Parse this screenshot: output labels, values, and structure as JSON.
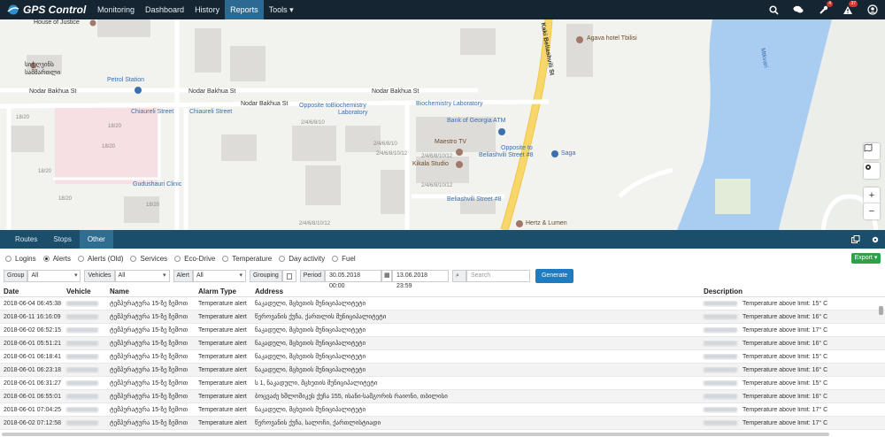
{
  "app": {
    "logo_text": "GPS Control"
  },
  "nav": [
    "Monitoring",
    "Dashboard",
    "History",
    "Reports",
    "Tools"
  ],
  "nav_active": "Reports",
  "top_icons": {
    "wrench_badge": "4",
    "alert_badge": "37"
  },
  "map": {
    "labels": {
      "house_of_justice": "House of Justice",
      "geo_top": "სიჭ ღვინს",
      "geo_bottom": "სამმართლი",
      "petrol_station": "Petrol Station",
      "nodar1": "Nodar Bakhua St",
      "nodar2": "Nodar Bakhua St",
      "nodar3": "Nodar Bakhua St",
      "nodar4": "Nodar Bakhua St",
      "chiaureli1": "Chiaureli Street",
      "chiaureli2": "Chiaureli Street",
      "opposite_bio_1": "Opposite toBiochemistry",
      "opposite_bio_2": "Laboratory",
      "bio_lab": "Biochemistry Laboratory",
      "bank": "Bank of Georgia ATM",
      "maestro": "Maestro TV",
      "kikala": "Kikala Studio",
      "opposite_bel_1": "Opposite to",
      "opposite_bel_2": "Beliashvili Street #8",
      "saga": "Saga",
      "beliashvili8": "Beliashvili Street #8",
      "gudushauri": "Gudushauri Clinic",
      "hertz": "Hertz & Lumen",
      "agava": "Agava hotel Tbilisi",
      "beliashvili_road": "Kaki Beliashvili St",
      "mtkvari": "Mtkvari",
      "n1820a": "18/20",
      "n1820b": "18/20",
      "n1820c": "18/20",
      "n1820d": "18/20",
      "n1820e": "18/20",
      "n18": "18/20",
      "n246a": "2/4/6/8/10",
      "n246b": "2/4/6/8/10",
      "n246c": "2/4/6/8/10/12",
      "n246d": "2/4/6/8/10/12",
      "n246e": "2/4/6/8/10/12",
      "n246f": "2/4/6/8/10/12"
    },
    "controls": {
      "zoom_in": "+",
      "zoom_out": "−"
    }
  },
  "tabs": [
    "Routes",
    "Stops",
    "Other"
  ],
  "tab_active": "Other",
  "report_types": [
    {
      "label": "Logins",
      "selected": false
    },
    {
      "label": "Alerts",
      "selected": true
    },
    {
      "label": "Alerts (Old)",
      "selected": false
    },
    {
      "label": "Services",
      "selected": false
    },
    {
      "label": "Eco-Drive",
      "selected": false
    },
    {
      "label": "Temperature",
      "selected": false
    },
    {
      "label": "Day activity",
      "selected": false
    },
    {
      "label": "Fuel",
      "selected": false
    }
  ],
  "export_label": "Export",
  "filters": {
    "group_label": "Group",
    "group_value": "All",
    "vehicles_label": "Vehicles",
    "vehicles_value": "All",
    "alert_label": "Alert",
    "alert_value": "All",
    "grouping_label": "Grouping",
    "period_label": "Period",
    "from": "30.05.2018 00:00",
    "to": "13.06.2018 23:59",
    "search_placeholder": "Search",
    "generate_label": "Generate"
  },
  "table": {
    "columns": [
      "Date",
      "Vehicle",
      "Name",
      "Alarm Type",
      "Address",
      "Description"
    ],
    "rows": [
      {
        "date": "2018-06-04 06:45:38",
        "name": "ტემპერატურა 15-ზე ზემოთ",
        "type": "Temperature alert",
        "address": "ნაკადული, მცხეთის მუნიციპალიტეტი",
        "desc": "Temperature above limit: 15° C"
      },
      {
        "date": "2018-06-11 16:16:09",
        "name": "ტემპერატურა 15-ზე ზემოთ",
        "type": "Temperature alert",
        "address": "წეროვანის ქუჩა, ქართლის მუნიციპალიტეტი",
        "desc": "Temperature above limit: 16° C"
      },
      {
        "date": "2018-06-02 06:52:15",
        "name": "ტემპერატურა 15-ზე ზემოთ",
        "type": "Temperature alert",
        "address": "ნაკადული, მცხეთის მუნიციპალიტეტი",
        "desc": "Temperature above limit: 17° C"
      },
      {
        "date": "2018-06-01 05:51:21",
        "name": "ტემპერატურა 15-ზე ზემოთ",
        "type": "Temperature alert",
        "address": "ნაკადული, მცხეთის მუნიციპალიტეტი",
        "desc": "Temperature above limit: 16° C"
      },
      {
        "date": "2018-06-01 06:18:41",
        "name": "ტემპერატურა 15-ზე ზემოთ",
        "type": "Temperature alert",
        "address": "ნაკადული, მცხეთის მუნიციპალიტეტი",
        "desc": "Temperature above limit: 15° C"
      },
      {
        "date": "2018-06-01 06:23:18",
        "name": "ტემპერატურა 15-ზე ზემოთ",
        "type": "Temperature alert",
        "address": "ნაკადული, მცხეთის მუნიციპალიტეტი",
        "desc": "Temperature above limit: 16° C"
      },
      {
        "date": "2018-06-01 06:31:27",
        "name": "ტემპერატურა 15-ზე ზემოთ",
        "type": "Temperature alert",
        "address": "ს 1, ნაკადული, მცხეთის მუნიციპალიტეტი",
        "desc": "Temperature above limit: 15° C"
      },
      {
        "date": "2018-06-01 06:55:01",
        "name": "ტემპერატურა 15-ზე ზემოთ",
        "type": "Temperature alert",
        "address": "ბოცვაძე ხშლოშიკეს ქუჩა 155, ისანი-სამგორის რაიონი, თბილისი",
        "desc": "Temperature above limit: 16° C"
      },
      {
        "date": "2018-06-01 07:04:25",
        "name": "ტემპერატურა 15-ზე ზემოთ",
        "type": "Temperature alert",
        "address": "ნაკადული, მცხეთის მუნიციპალიტეტი",
        "desc": "Temperature above limit: 17° C"
      },
      {
        "date": "2018-06-02 07:12:58",
        "name": "ტემპერატურა 15-ზე ზემოთ",
        "type": "Temperature alert",
        "address": "წეროვანის ქუჩა, სალოჩი, ქართლისტიადი",
        "desc": "Temperature above limit: 17° C"
      }
    ]
  },
  "colors": {
    "topbar": "#152532",
    "nav_active": "#2c6a93",
    "tabsbar": "#1b4e6b",
    "generate": "#1f7cc1",
    "export": "#2da14b",
    "river": "#a8cdf0",
    "road_yellow": "#f7d66a"
  }
}
